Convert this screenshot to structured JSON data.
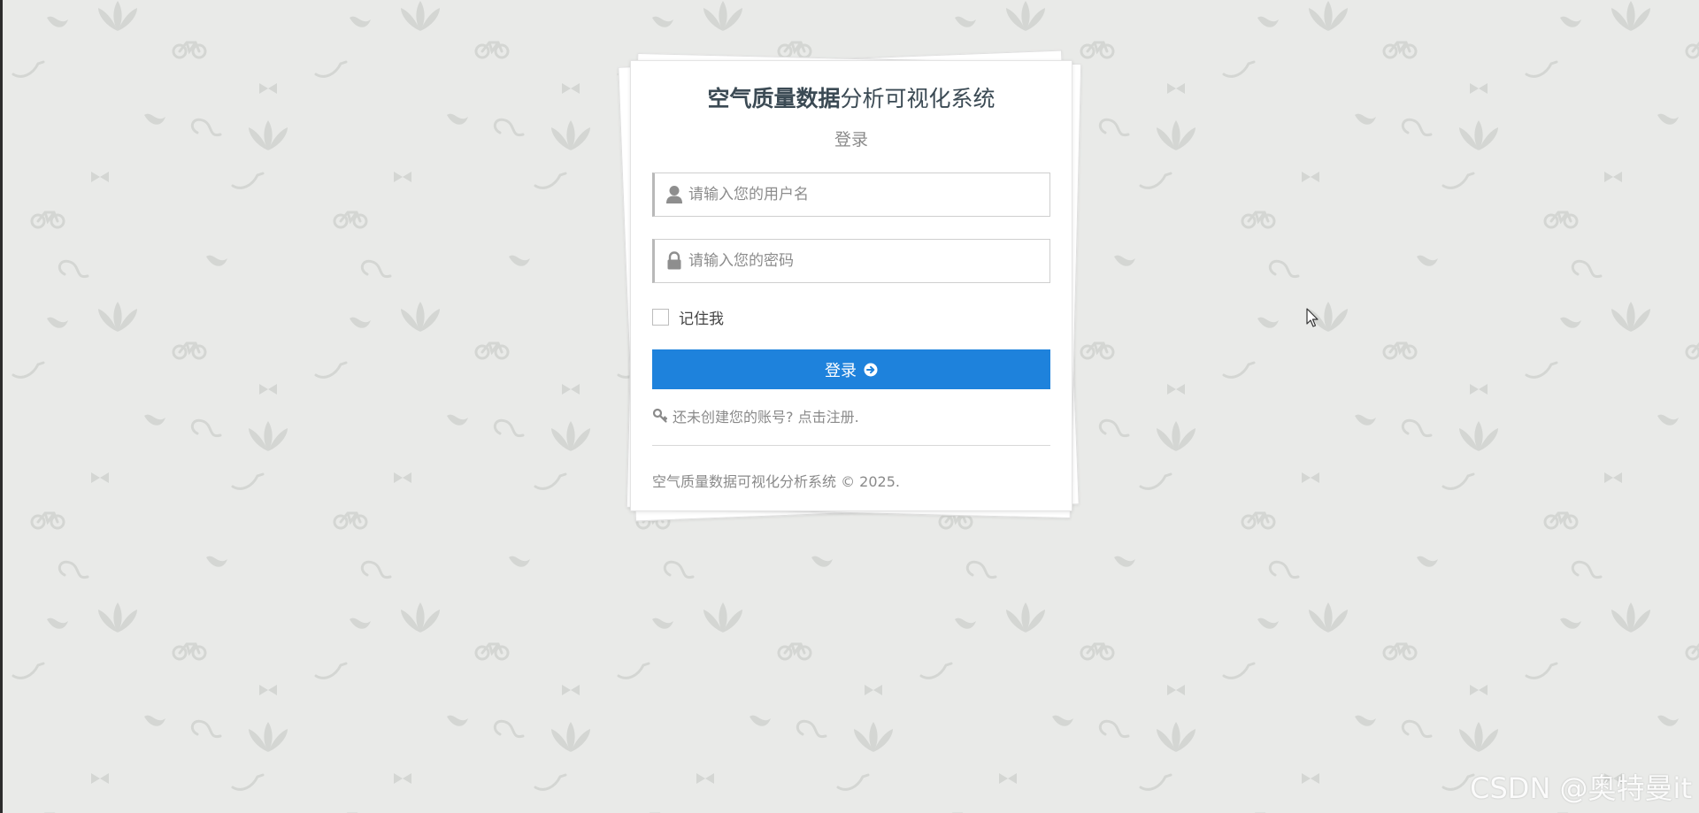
{
  "login": {
    "title_bold": "空气质量数据",
    "title_normal": "分析可视化系统",
    "subtitle": "登录",
    "username_placeholder": "请输入您的用户名",
    "password_placeholder": "请输入您的密码",
    "remember_label": "记住我",
    "login_button": "登录",
    "register_link": "还未创建您的账号? 点击注册.",
    "footer": "空气质量数据可视化分析系统 © 2025."
  },
  "icons": {
    "username": "user-icon",
    "password": "lock-icon",
    "login_button": "arrow-circle-right-icon",
    "register": "key-icon"
  },
  "colors": {
    "accent": "#1e82dc",
    "background": "#e9eae8"
  },
  "watermark": "CSDN @奥特曼it"
}
